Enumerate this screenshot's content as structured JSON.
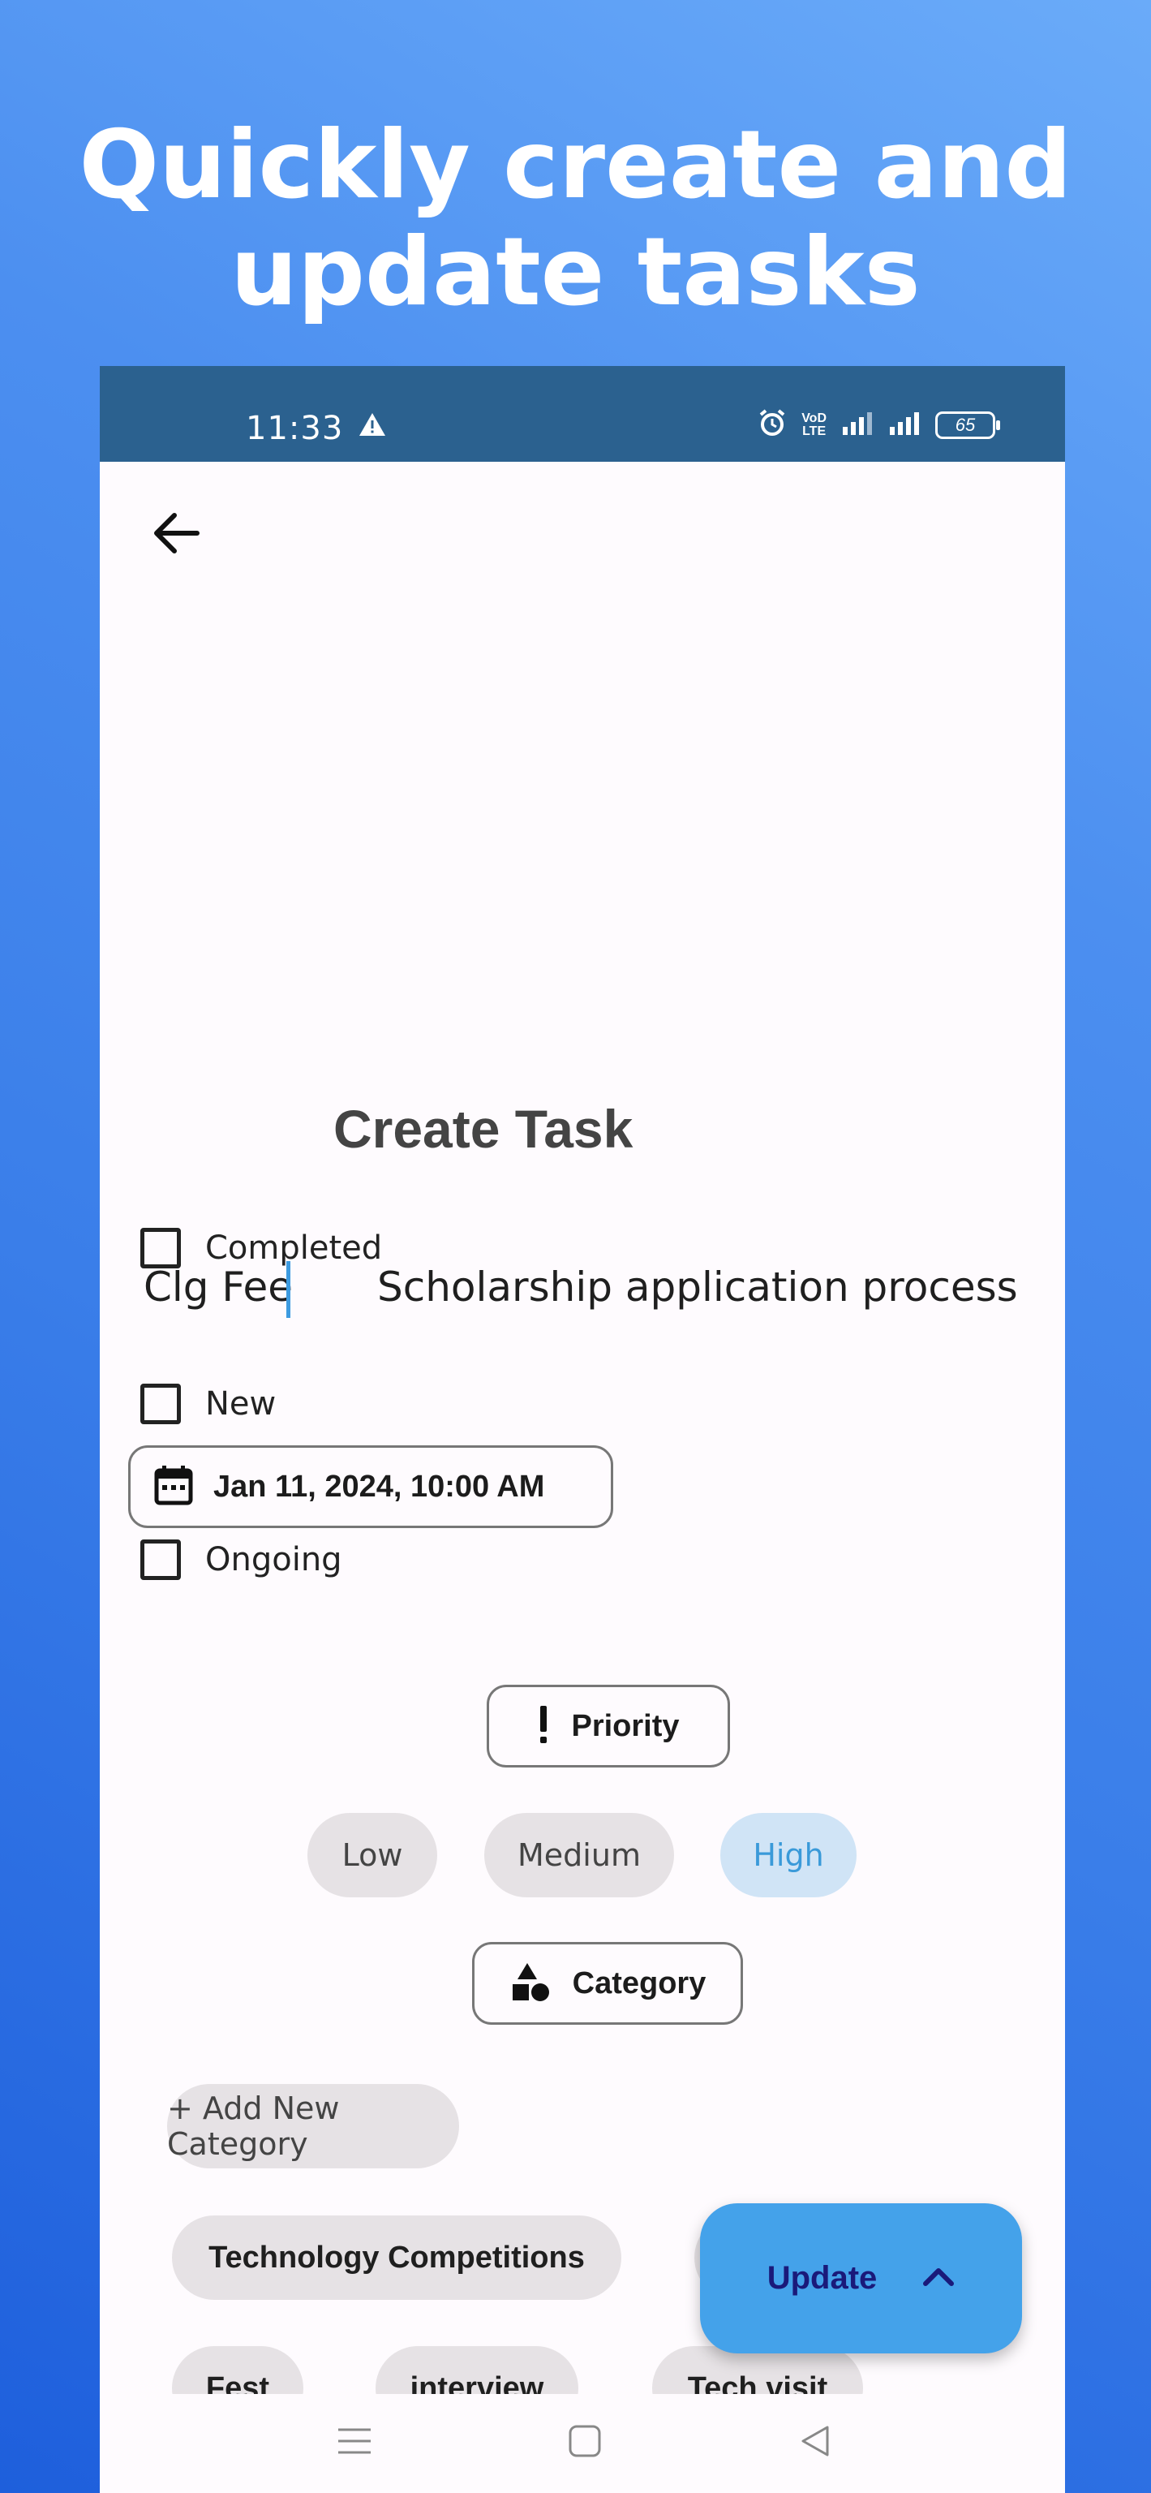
{
  "headline": {
    "line1": "Quickly create and",
    "line2": "update tasks"
  },
  "status_bar": {
    "time": "11:33",
    "network_label_top": "VoD",
    "network_label_bottom": "LTE",
    "battery": "65"
  },
  "page": {
    "title": "Create Task"
  },
  "task": {
    "title_value": "Clg Fee",
    "description_value": "Scholarship application process"
  },
  "due_date": {
    "label": "Jan 11, 2024, 10:00 AM"
  },
  "statuses": [
    {
      "label": "Completed",
      "checked": false
    },
    {
      "label": "New",
      "checked": false
    },
    {
      "label": "Ongoing",
      "checked": false
    }
  ],
  "priority": {
    "button_label": "Priority",
    "options": [
      "Low",
      "Medium",
      "High"
    ],
    "selected": "High"
  },
  "category": {
    "button_label": "Category",
    "add_label": "+ Add New Category",
    "items": [
      "Technology Competitions",
      "Fest",
      "interview",
      "Tech visit"
    ]
  },
  "fab": {
    "label": "Update"
  },
  "icons": {
    "back": "arrow-left-icon",
    "calendar": "calendar-icon",
    "priority": "exclamation-icon",
    "category": "shapes-icon",
    "fab": "chevron-up-icon"
  },
  "colors": {
    "status_bar": "#2b618f",
    "fab": "#44a2ea",
    "selected_chip_bg": "#d0e4f6",
    "selected_chip_text": "#3a9ad9",
    "caret": "#3d9be0"
  }
}
